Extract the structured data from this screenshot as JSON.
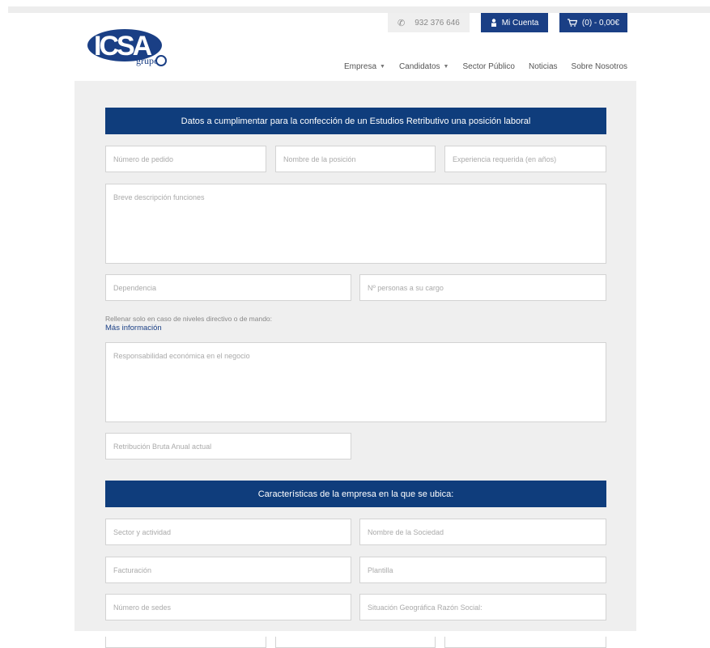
{
  "header": {
    "logo": {
      "text": "ICSA",
      "sub": "grupo"
    },
    "phone": "932 376 646",
    "account_label": "Mi Cuenta",
    "cart_label": "(0) - 0,00€"
  },
  "nav": {
    "items": [
      {
        "label": "Empresa",
        "dropdown": true
      },
      {
        "label": "Candidatos",
        "dropdown": true
      },
      {
        "label": "Sector Público",
        "dropdown": false
      },
      {
        "label": "Noticias",
        "dropdown": false
      },
      {
        "label": "Sobre Nosotros",
        "dropdown": false
      }
    ]
  },
  "form": {
    "section1_title": "Datos a cumplimentar para la confección de un Estudios Retributivo una posición laboral",
    "numero_pedido": "Número de pedido",
    "nombre_posicion": "Nombre de la posición",
    "experiencia": "Experiencia requerida (en años)",
    "descripcion": "Breve descripción funciones",
    "dependencia": "Dependencia",
    "personas_cargo": "Nº personas a su cargo",
    "note": "Rellenar solo en caso de niveles directivo o de mando:",
    "note_link": "Más información",
    "responsabilidad": "Responsabilidad económica en el negocio",
    "retribucion": "Retribución Bruta Anual actual",
    "section2_title": "Características de la empresa en la que se ubica:",
    "sector": "Sector y actividad",
    "nombre_sociedad": "Nombre de la Sociedad",
    "facturacion": "Facturación",
    "plantilla": "Plantilla",
    "numero_sedes": "Número de sedes",
    "situacion": "Situación Geográfica Razón Social:"
  },
  "colors": {
    "brand": "#1a3f85",
    "section": "#0f3d7c",
    "background": "#efefef"
  }
}
